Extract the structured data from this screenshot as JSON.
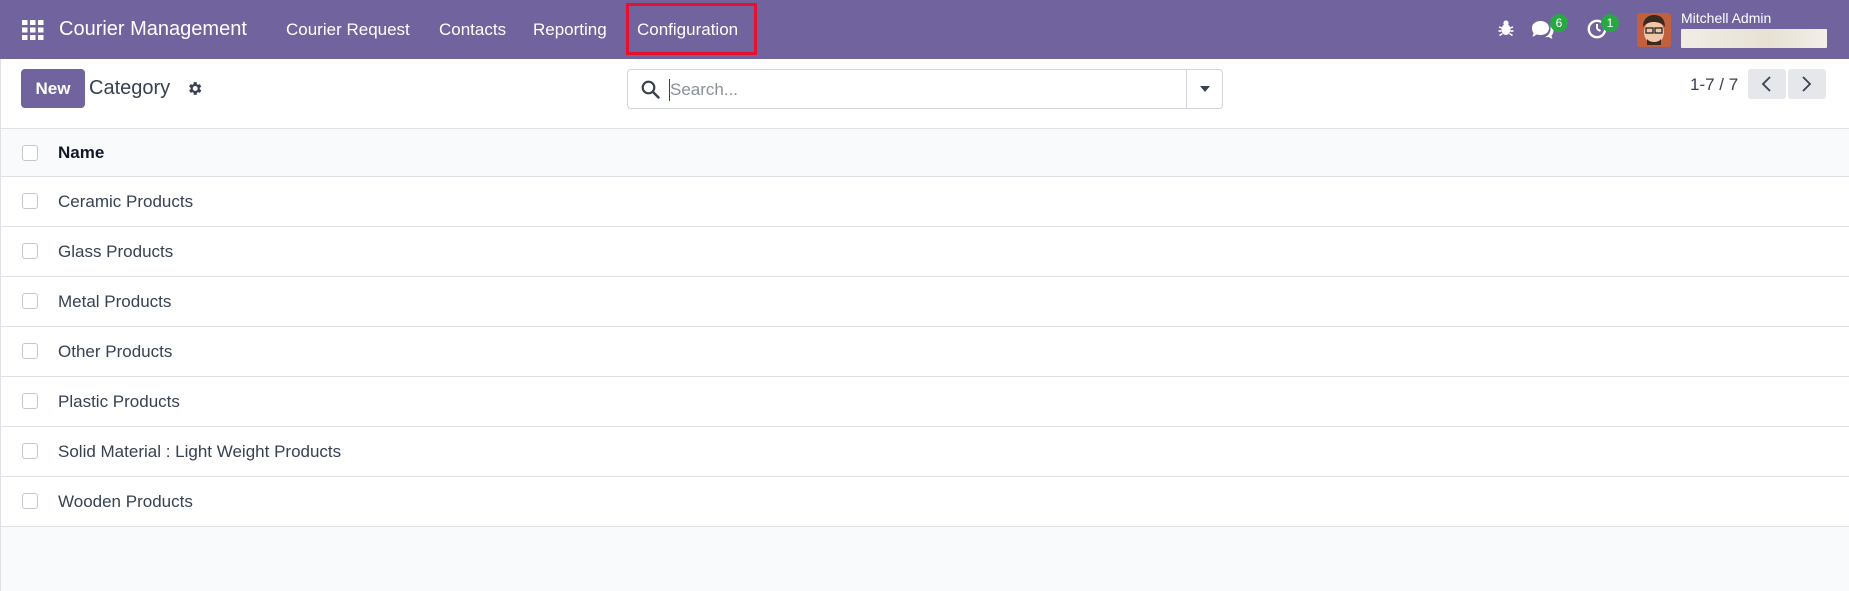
{
  "topbar": {
    "brand": "Courier Management",
    "menu": [
      {
        "label": "Courier Request"
      },
      {
        "label": "Contacts"
      },
      {
        "label": "Reporting"
      },
      {
        "label": "Configuration"
      }
    ],
    "messages_count": "6",
    "activities_count": "1",
    "user_name": "Mitchell Admin",
    "icons": [
      "apps-grid-icon",
      "bug-icon",
      "chat-icon",
      "clock-icon"
    ]
  },
  "control_panel": {
    "new_label": "New",
    "breadcrumb": "Category",
    "search_placeholder": "Search...",
    "pager": "1-7 / 7"
  },
  "list": {
    "columns": [
      "Name"
    ],
    "rows": [
      "Ceramic Products",
      "Glass Products",
      "Metal Products",
      "Other Products",
      "Plastic Products",
      "Solid Material : Light Weight Products",
      "Wooden Products"
    ]
  },
  "colors": {
    "brand": "#71639e",
    "highlight": "#e8112d",
    "badge": "#28a745"
  }
}
